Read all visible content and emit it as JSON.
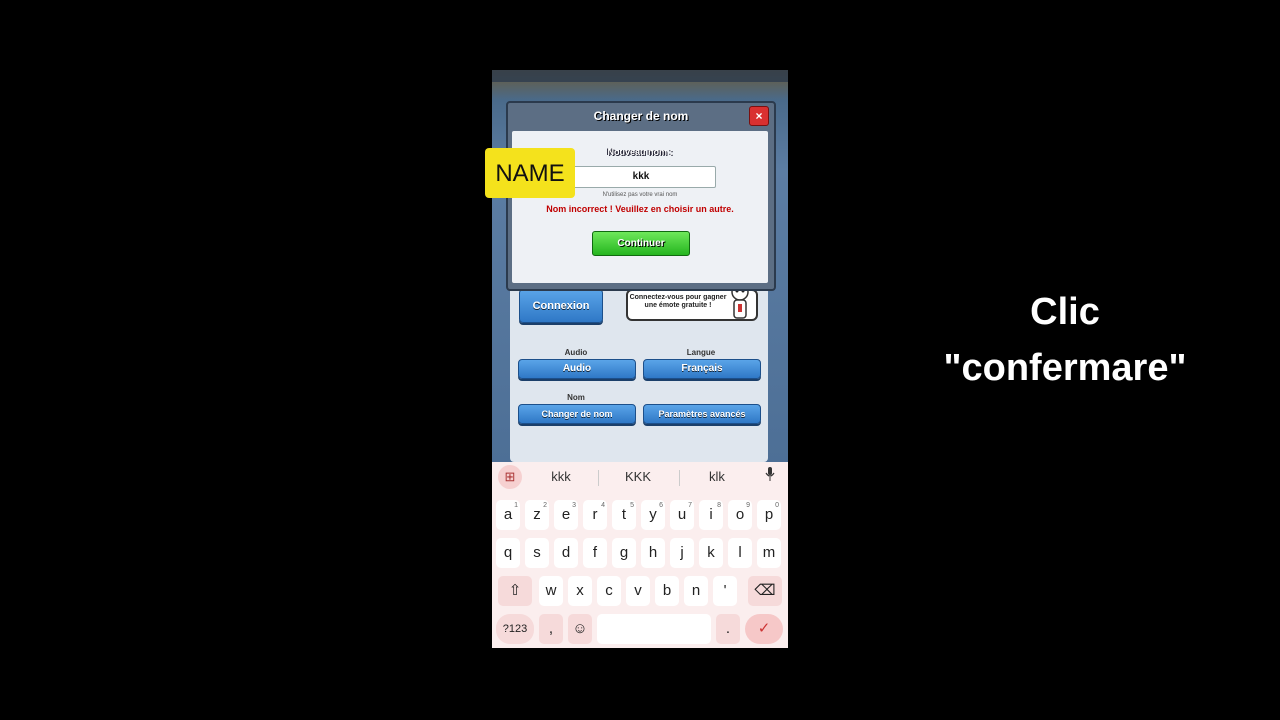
{
  "dialog": {
    "title": "Changer de nom",
    "close": "×",
    "new_name_label": "Nouveau nom :",
    "name_value": "kkk",
    "hint": "N'utilisez pas votre vrai nom",
    "error": "Nom incorrect ! Veuillez en choisir un autre.",
    "continue_label": "Continuer"
  },
  "settings": {
    "connexion_label": "Connexion",
    "speech": "Connectez-vous pour gagner une émote gratuite !",
    "audio_label": "Audio",
    "audio_button": "Audio",
    "langue_label": "Langue",
    "langue_button": "Français",
    "nom_label": "Nom",
    "change_name_button": "Changer de nom",
    "advanced_button": "Paramètres avancés"
  },
  "keyboard": {
    "suggestions": [
      "kkk",
      "KKK",
      "klk"
    ],
    "row1": [
      {
        "k": "a",
        "n": "1"
      },
      {
        "k": "z",
        "n": "2"
      },
      {
        "k": "e",
        "n": "3"
      },
      {
        "k": "r",
        "n": "4"
      },
      {
        "k": "t",
        "n": "5"
      },
      {
        "k": "y",
        "n": "6"
      },
      {
        "k": "u",
        "n": "7"
      },
      {
        "k": "i",
        "n": "8"
      },
      {
        "k": "o",
        "n": "9"
      },
      {
        "k": "p",
        "n": "0"
      }
    ],
    "row2": [
      "q",
      "s",
      "d",
      "f",
      "g",
      "h",
      "j",
      "k",
      "l",
      "m"
    ],
    "row3": [
      "w",
      "x",
      "c",
      "v",
      "b",
      "n",
      "'"
    ],
    "symbols_key": "?123",
    "comma_key": ",",
    "period_key": ".",
    "shift_icon": "⇧",
    "backspace_icon": "⌫",
    "emoji_icon": "☺",
    "enter_icon": "✓",
    "mic_icon": "🎤",
    "apps_icon": "⊞",
    "accent_color": "#f6c8c8"
  },
  "overlay": {
    "name_tag": "NAME",
    "caption_line1": "Clic",
    "caption_line2": "\"confermare\""
  }
}
